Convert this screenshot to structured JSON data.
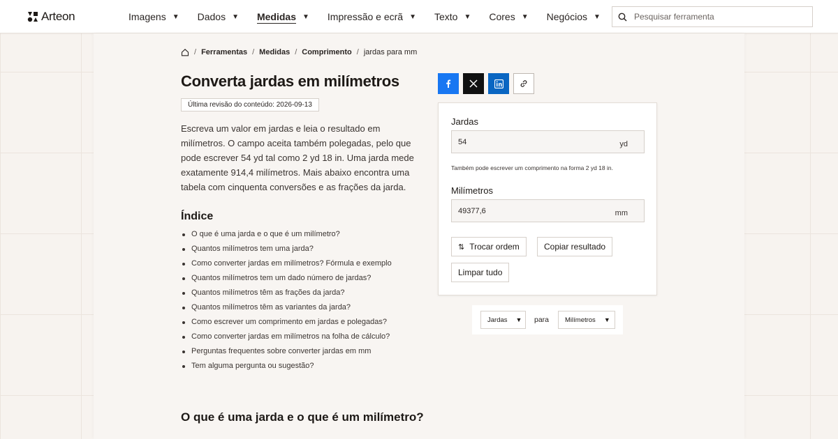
{
  "brand": {
    "name": "Arteon"
  },
  "nav": {
    "items": [
      {
        "label": "Imagens",
        "active": false
      },
      {
        "label": "Dados",
        "active": false
      },
      {
        "label": "Medidas",
        "active": true
      },
      {
        "label": "Impressão e ecrã",
        "active": false
      },
      {
        "label": "Texto",
        "active": false
      },
      {
        "label": "Cores",
        "active": false
      },
      {
        "label": "Negócios",
        "active": false
      }
    ],
    "caret": "▼"
  },
  "search": {
    "placeholder": "Pesquisar ferramenta"
  },
  "breadcrumb": {
    "items": [
      "Ferramentas",
      "Medidas",
      "Comprimento"
    ],
    "current": "jardas para mm",
    "separator": "/"
  },
  "page": {
    "title": "Converta jardas em milímetros",
    "revised": "Última revisão do conteúdo: 2026-09-13",
    "intro": "Escreva um valor em jardas e leia o resultado em milímetros. O campo aceita também polegadas, pelo que pode escrever 54 yd tal como 2 yd 18 in. Uma jarda mede exatamente 914,4 milímetros. Mais abaixo encontra uma tabela com cinquenta conversões e as frações da jarda.",
    "toc_title": "Índice",
    "toc": [
      "O que é uma jarda e o que é um milímetro?",
      "Quantos milímetros tem uma jarda?",
      "Como converter jardas em milímetros? Fórmula e exemplo",
      "Quantos milímetros tem um dado número de jardas?",
      "Quantos milímetros têm as frações da jarda?",
      "Quantos milímetros têm as variantes da jarda?",
      "Como escrever um comprimento em jardas e polegadas?",
      "Como converter jardas em milímetros na folha de cálculo?",
      "Perguntas frequentes sobre converter jardas em mm",
      "Tem alguma pergunta ou sugestão?"
    ],
    "section_heading": "O que é uma jarda e o que é um milímetro?"
  },
  "share": {
    "icons": [
      "facebook-icon",
      "x-icon",
      "linkedin-icon",
      "link-icon"
    ],
    "colors": {
      "facebook": "#1877f2",
      "x": "#111111",
      "linkedin": "#0a66c2"
    }
  },
  "converter": {
    "from_label": "Jardas",
    "from_value": "54",
    "from_unit": "yd",
    "hint": "Também pode escrever um comprimento na forma 2 yd 18 in.",
    "to_label": "Milímetros",
    "to_value": "49377,6",
    "to_unit": "mm",
    "swap_label": "Trocar ordem",
    "swap_icon": "⇅",
    "copy_label": "Copiar resultado",
    "clear_label": "Limpar tudo"
  },
  "unit_selector": {
    "from": "Jardas",
    "connector": "para",
    "to": "Milímetros",
    "caret": "▼"
  }
}
